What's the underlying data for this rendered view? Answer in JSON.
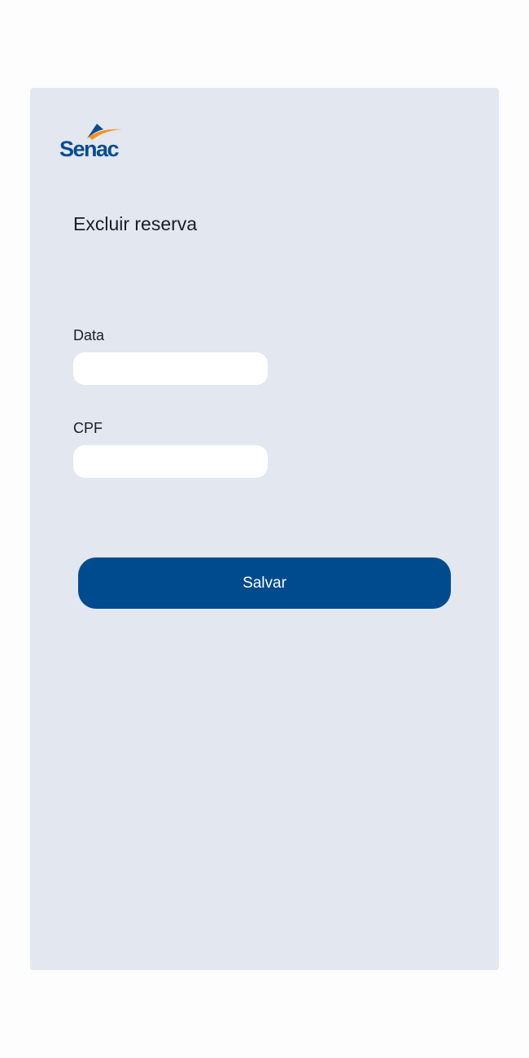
{
  "brand": {
    "logo_text": "Senac",
    "colors": {
      "blue": "#0a4c8f",
      "orange": "#f7941d"
    }
  },
  "page": {
    "title": "Excluir reserva"
  },
  "form": {
    "date_label": "Data",
    "date_value": "",
    "cpf_label": "CPF",
    "cpf_value": ""
  },
  "actions": {
    "save_label": "Salvar"
  },
  "colors": {
    "card_background": "#e2e7f0",
    "button_background": "#004b8d",
    "input_background": "#ffffff"
  }
}
